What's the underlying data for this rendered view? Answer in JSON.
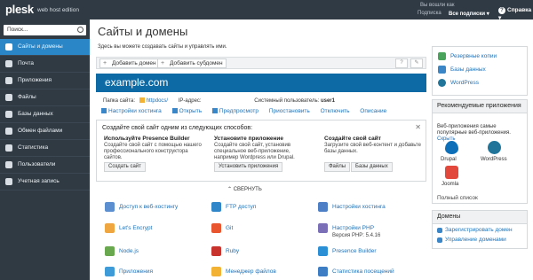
{
  "header": {
    "logo": "plesk",
    "edition": "web host edition",
    "login_label": "Вы вошли как",
    "subscription_label": "Подписка",
    "subscription_value": "Все подписки ▾",
    "help": "Справка ▾"
  },
  "sidebar": {
    "search_placeholder": "Поиск...",
    "items": [
      {
        "label": "Сайты и домены",
        "active": true
      },
      {
        "label": "Почта"
      },
      {
        "label": "Приложения"
      },
      {
        "label": "Файлы"
      },
      {
        "label": "Базы данных"
      },
      {
        "label": "Обмен файлами"
      },
      {
        "label": "Статистика"
      },
      {
        "label": "Пользователи"
      },
      {
        "label": "Учетная запись"
      }
    ]
  },
  "main": {
    "title": "Сайты и домены",
    "description": "Здесь вы можете создавать сайты и управлять ими.",
    "toolbar": {
      "add_domain": "Добавить домен",
      "add_subdomain": "Добавить субдомен",
      "help_btn": "?",
      "tools_btn": "✎"
    },
    "domain": {
      "name": "example.com",
      "folder_label": "Папка сайта:",
      "folder_value": "httpdocs/",
      "ip_label": "IP-адрес:",
      "ip_value": "",
      "sysuser_label": "Системный пользователь:",
      "sysuser_value": "user1",
      "links": [
        "Настройки хостинга",
        "Открыть",
        "Предпросмотр",
        "Приостановить",
        "Отключить",
        "Описание"
      ]
    },
    "create": {
      "heading": "Создайте свой сайт одним из следующих способов:",
      "columns": [
        {
          "title": "Используйте Presence Builder",
          "text": "Создайте свой сайт с помощью нашего профессионального конструктора сайтов.",
          "buttons": [
            "Создать сайт"
          ]
        },
        {
          "title": "Установите приложение",
          "text": "Создайте свой сайт, установив специальное веб-приложение, например Wordpress или Drupal.",
          "buttons": [
            "Установить приложения"
          ]
        },
        {
          "title": "Создайте свой сайт",
          "text": "Загрузите свой веб-контент и добавьте базы данных.",
          "buttons": [
            "Файлы",
            "Базы данных"
          ]
        }
      ],
      "collapse": "⌃ СВЕРНУТЬ"
    },
    "features": [
      {
        "label": "Доступ к веб-хостингу",
        "color": "#5b8fd0"
      },
      {
        "label": "FTP доступ",
        "color": "#2f86c9"
      },
      {
        "label": "Настройки хостинга",
        "color": "#4d7fc6"
      },
      {
        "label": "Let's Encrypt",
        "color": "#f0a640"
      },
      {
        "label": "Git",
        "color": "#e8552f"
      },
      {
        "label": "Настройки PHP",
        "sub": "Версия PHP: 5.4.16",
        "color": "#7b6fb8"
      },
      {
        "label": "Node.js",
        "color": "#6aa84f"
      },
      {
        "label": "Ruby",
        "color": "#c8332d"
      },
      {
        "label": "Presence Builder",
        "color": "#2b8fd6"
      },
      {
        "label": "Приложения",
        "color": "#3f9bd8"
      },
      {
        "label": "Менеджер файлов",
        "color": "#f2b233"
      },
      {
        "label": "Статистика посещений",
        "color": "#3c7dc4"
      }
    ]
  },
  "right": {
    "top_links": [
      "Резервные копии",
      "Базы данных",
      "WordPress"
    ],
    "apps": {
      "heading": "Рекомендуемые приложения",
      "text": "Веб-приложения самые популярные веб-приложения.",
      "hide": "Скрыть",
      "items": [
        "Drupal",
        "WordPress",
        "Joomla"
      ],
      "full_list": "Полный список"
    },
    "domains": {
      "heading": "Домены",
      "links": [
        "Зарегистрировать домен",
        "Управление доменами"
      ]
    }
  }
}
